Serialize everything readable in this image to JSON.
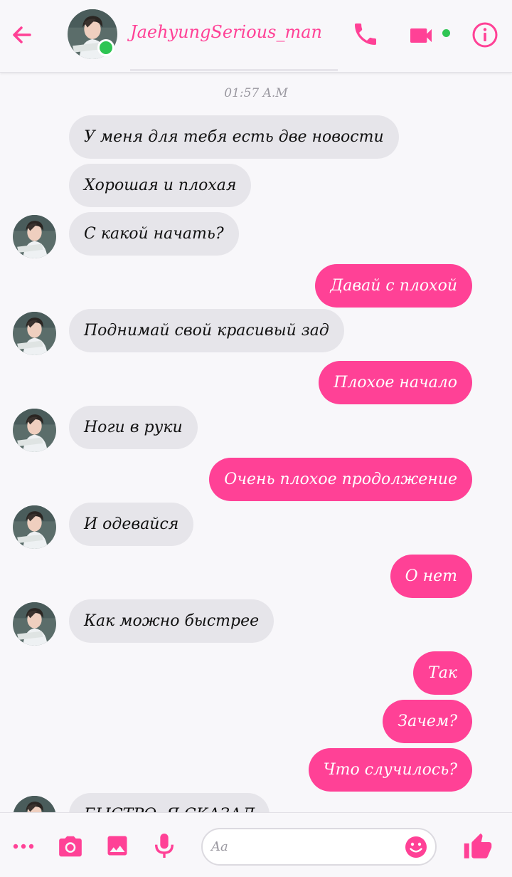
{
  "header": {
    "contact_name": "JaehyungSerious_man",
    "online": true
  },
  "conversation": {
    "timestamp": "01:57 A.M",
    "messages": [
      {
        "side": "in",
        "text": "У меня для тебя есть две новости"
      },
      {
        "side": "in",
        "text": "Хорошая и плохая"
      },
      {
        "side": "in",
        "text": "С какой начать?"
      },
      {
        "side": "out",
        "text": "Давай с плохой"
      },
      {
        "side": "in",
        "text": "Поднимай свой красивый зад"
      },
      {
        "side": "out",
        "text": "Плохое начало"
      },
      {
        "side": "in",
        "text": "Ноги в руки"
      },
      {
        "side": "out",
        "text": "Очень плохое продолжение"
      },
      {
        "side": "in",
        "text": "И одевайся"
      },
      {
        "side": "out",
        "text": "О нет"
      },
      {
        "side": "in",
        "text": "Как можно быстрее"
      },
      {
        "side": "out",
        "text": "Так"
      },
      {
        "side": "out",
        "text": "Зачем?"
      },
      {
        "side": "out",
        "text": "Что случилось?"
      },
      {
        "side": "in",
        "text": "БЫСТРО, Я СКАЗАЛ"
      }
    ]
  },
  "composer": {
    "placeholder": "Aa"
  },
  "colors": {
    "accent": "#ff4196",
    "incoming_bubble": "#e6e5ea",
    "online": "#2fc553",
    "background": "#f8f7fa"
  },
  "icons": [
    "back-arrow-icon",
    "phone-icon",
    "video-camera-icon",
    "info-icon",
    "more-dots-icon",
    "camera-icon",
    "image-icon",
    "microphone-icon",
    "emoji-icon",
    "thumbs-up-icon"
  ]
}
